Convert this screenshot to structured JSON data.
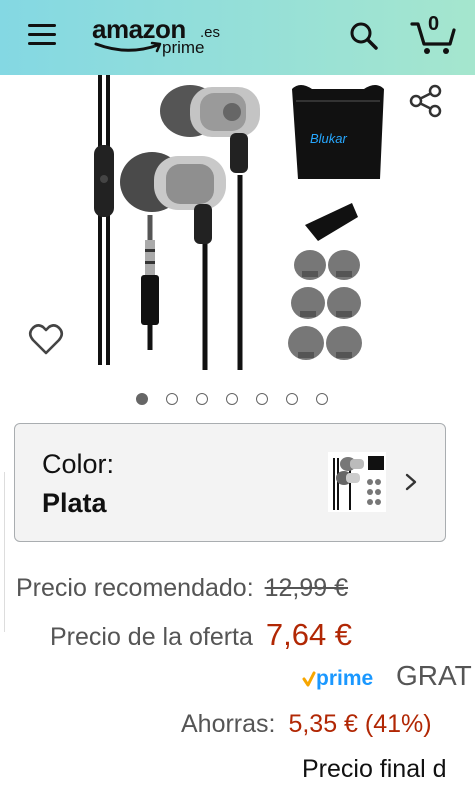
{
  "header": {
    "logo_text": "amazon",
    "logo_suffix": ".es",
    "logo_prime": "prime",
    "cart_count": "0",
    "icons": {
      "menu": "hamburger-menu-icon",
      "search": "search-icon",
      "cart": "cart-icon"
    }
  },
  "gallery": {
    "brand_on_pouch": "Blukar",
    "total_images": 7,
    "active_index": 0,
    "icons": {
      "share": "share-icon",
      "wishlist": "heart-icon"
    }
  },
  "variation": {
    "label": "Color:",
    "value": "Plata"
  },
  "pricing": {
    "list_label": "Precio recomendado:",
    "list_price": "12,99 €",
    "deal_label": "Precio de la oferta",
    "deal_price": "7,64 €",
    "prime_badge": "prime",
    "shipping": "GRAT",
    "savings_label": "Ahorras:",
    "savings_value": "5,35 € (41%)",
    "final_text": "Precio final d"
  },
  "colors": {
    "header_start": "#84d8e3",
    "header_end": "#a5e6ce",
    "price_red": "#b12704",
    "prime_blue": "#1a98ff",
    "prime_check": "#f7a600"
  }
}
